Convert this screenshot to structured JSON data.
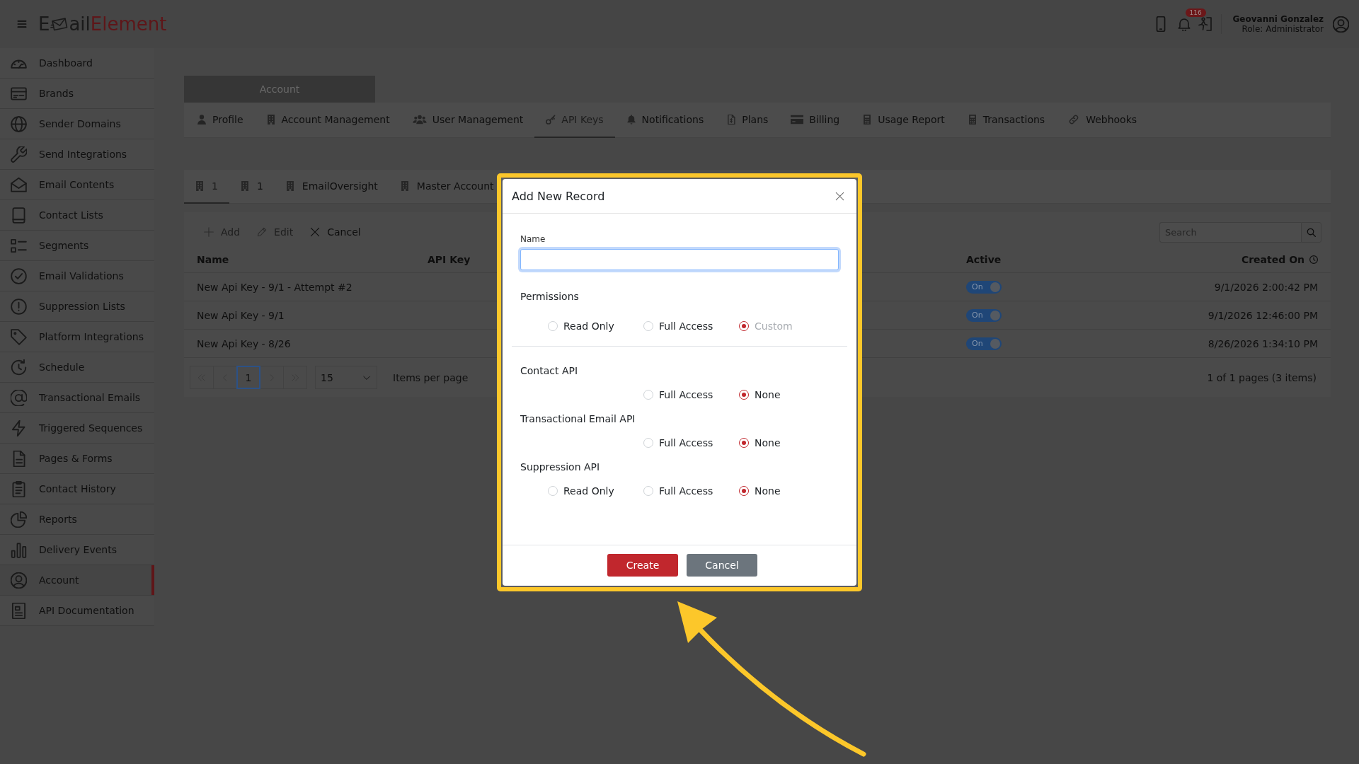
{
  "header": {
    "logo": {
      "before_icon": "E",
      "after_icon": "ail",
      "accent": "Element"
    },
    "notification_count": "116",
    "user": {
      "name": "Geovanni Gonzalez",
      "role": "Role: Administrator"
    }
  },
  "sidebar": {
    "items": [
      {
        "label": "Dashboard",
        "selected": false
      },
      {
        "label": "Brands",
        "selected": false
      },
      {
        "label": "Sender Domains",
        "selected": false
      },
      {
        "label": "Send Integrations",
        "selected": false
      },
      {
        "label": "Email Contents",
        "selected": false
      },
      {
        "label": "Contact Lists",
        "selected": false
      },
      {
        "label": "Segments",
        "selected": false
      },
      {
        "label": "Email Validations",
        "selected": false
      },
      {
        "label": "Suppression Lists",
        "selected": false
      },
      {
        "label": "Platform Integrations",
        "selected": false
      },
      {
        "label": "Schedule",
        "selected": false
      },
      {
        "label": "Transactional Emails",
        "selected": false
      },
      {
        "label": "Triggered Sequences",
        "selected": false
      },
      {
        "label": "Pages & Forms",
        "selected": false
      },
      {
        "label": "Contact History",
        "selected": false
      },
      {
        "label": "Reports",
        "selected": false
      },
      {
        "label": "Delivery Events",
        "selected": false
      },
      {
        "label": "Account",
        "selected": true
      },
      {
        "label": "API Documentation",
        "selected": false
      }
    ]
  },
  "account": {
    "heading": "Account",
    "tabs": [
      {
        "label": "Profile",
        "selected": false
      },
      {
        "label": "Account Management",
        "selected": false
      },
      {
        "label": "User Management",
        "selected": false
      },
      {
        "label": "API Keys",
        "selected": true
      },
      {
        "label": "Notifications",
        "selected": false
      },
      {
        "label": "Plans",
        "selected": false
      },
      {
        "label": "Billing",
        "selected": false
      },
      {
        "label": "Usage Report",
        "selected": false
      },
      {
        "label": "Transactions",
        "selected": false
      },
      {
        "label": "Webhooks",
        "selected": false
      }
    ],
    "sub_tabs": [
      {
        "label": "1",
        "selected": true
      },
      {
        "label": "1",
        "selected": false
      },
      {
        "label": "EmailOversight",
        "selected": false
      },
      {
        "label": "Master Account",
        "selected": false
      }
    ],
    "toolbar": {
      "buttons": [
        {
          "label": "Add",
          "disabled": true
        },
        {
          "label": "Edit",
          "disabled": true
        },
        {
          "label": "Cancel",
          "disabled": false
        }
      ],
      "search": {
        "placeholder": "Search"
      }
    },
    "table": {
      "columns": [
        "Name",
        "API Key",
        "Active",
        "Created On"
      ],
      "rows": [
        {
          "name": "New Api Key - 9/1 - Attempt #2",
          "active": {
            "label": "On",
            "on": true
          },
          "created_on": "9/1/2026 2:00:42 PM"
        },
        {
          "name": "New Api Key - 9/1",
          "active": {
            "label": "On",
            "on": true
          },
          "created_on": "9/1/2026 12:46:00 PM"
        },
        {
          "name": "New Api Key - 8/26",
          "active": {
            "label": "On",
            "on": true
          },
          "created_on": "8/26/2026 1:34:10 PM"
        }
      ]
    },
    "pagination": {
      "pages": [
        {
          "label": "1",
          "selected": true
        }
      ],
      "page_size": "15",
      "page_size_label": "Items per page",
      "summary": "1 of 1 pages (3 items)"
    }
  },
  "modal": {
    "title": "Add New Record",
    "name_field": {
      "label": "Name",
      "focused": true
    },
    "groups": [
      {
        "label": "Permissions",
        "options": [
          {
            "label": "Read Only",
            "selected": false,
            "disabled": false
          },
          {
            "label": "Full Access",
            "selected": false,
            "disabled": false
          },
          {
            "label": "Custom",
            "selected": true,
            "disabled": true
          }
        ]
      },
      {
        "label": "Contact API",
        "options": [
          {
            "label": "Full Access",
            "selected": false,
            "disabled": false
          },
          {
            "label": "None",
            "selected": true,
            "disabled": false
          }
        ]
      },
      {
        "label": "Transactional Email API",
        "options": [
          {
            "label": "Full Access",
            "selected": false,
            "disabled": false
          },
          {
            "label": "None",
            "selected": true,
            "disabled": false
          }
        ]
      },
      {
        "label": "Suppression API",
        "options": [
          {
            "label": "Read Only",
            "selected": false,
            "disabled": false
          },
          {
            "label": "Full Access",
            "selected": false,
            "disabled": false
          },
          {
            "label": "None",
            "selected": true,
            "disabled": false
          }
        ]
      }
    ],
    "buttons": [
      {
        "label": "Create",
        "kind": "primary"
      },
      {
        "label": "Cancel",
        "kind": "secondary"
      }
    ]
  }
}
